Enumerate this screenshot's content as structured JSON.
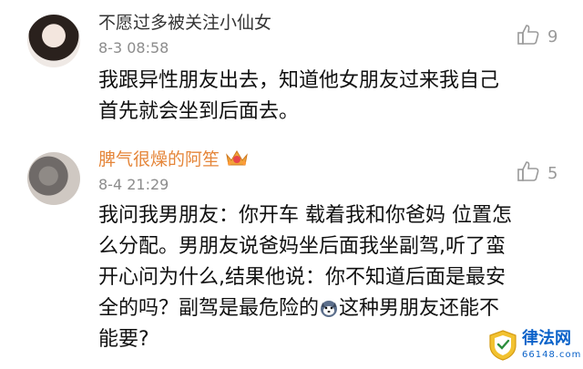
{
  "comments": [
    {
      "username": "不愿过多被关注小仙女",
      "timestamp": "8-3 08:58",
      "likes": "9",
      "text_lines": [
        "我跟异性朋友出去，知道他女朋友过来我自己",
        "首先就会坐到后面去。"
      ]
    },
    {
      "username": "脾气很燥的阿笙",
      "timestamp": "8-4 21:29",
      "likes": "5",
      "text_lines": [
        "我问我男朋友：你开车 载着我和你爸妈 位置怎",
        "么分配。男朋友说爸妈坐后面我坐副驾,听了蛮",
        "开心问为什么,结果他说：你不知道后面是最安",
        "全的吗？副驾是最危险的",
        "这种男朋友还能不",
        "能要?"
      ]
    }
  ],
  "watermark": {
    "title": "律法网",
    "subtitle": "66148.com"
  },
  "colors": {
    "username_highlight": "#e5863a",
    "meta_gray": "#8c8c8c",
    "watermark_blue": "#0a62c9"
  }
}
